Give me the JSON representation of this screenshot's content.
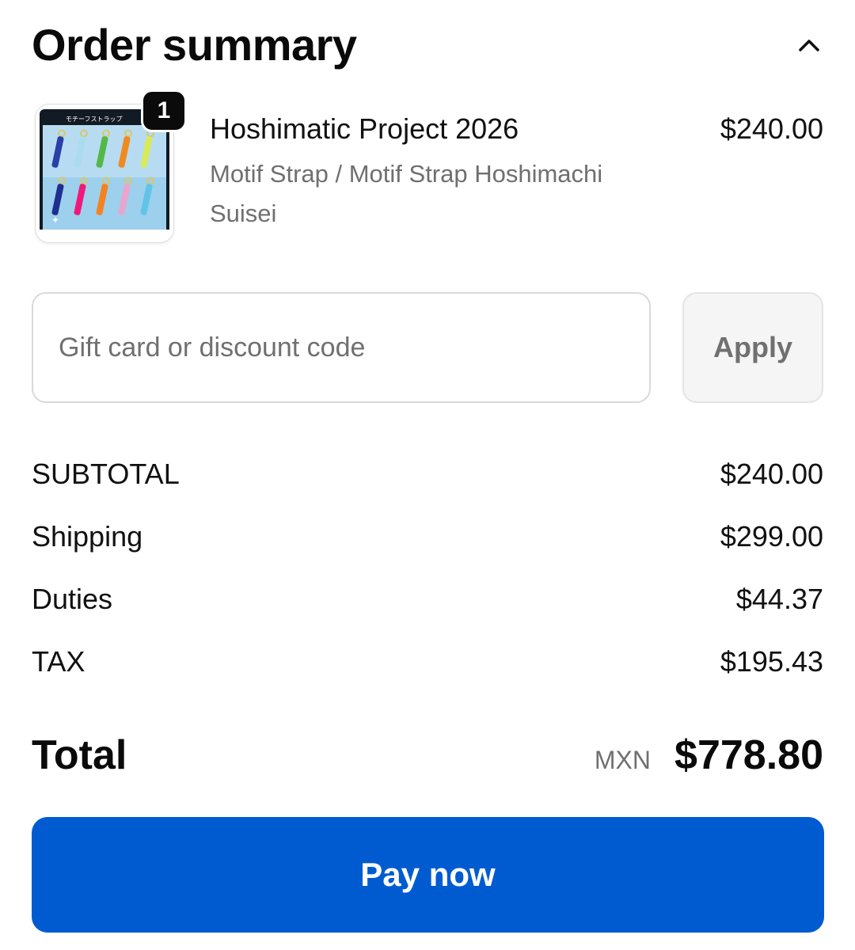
{
  "header": {
    "title": "Order summary",
    "toggle_icon": "chevron-up-icon"
  },
  "line_item": {
    "quantity": "1",
    "name": "Hoshimatic Project 2026",
    "variant": "Motif Strap / Motif Strap Hoshimachi Suisei",
    "price": "$240.00",
    "thumbnail": {
      "heading": "モチーフストラップ",
      "strap_colors": [
        "#2a3fa8",
        "#a9dcef",
        "#54b848",
        "#f08a1c",
        "#d8ea5a",
        "#1f2f8f",
        "#f0197a",
        "#f58220",
        "#e8a6cf",
        "#62c3e8"
      ]
    }
  },
  "discount": {
    "placeholder": "Gift card or discount code",
    "apply_label": "Apply"
  },
  "totals": [
    {
      "label": "SUBTOTAL",
      "value": "$240.00"
    },
    {
      "label": "Shipping",
      "value": "$299.00"
    },
    {
      "label": "Duties",
      "value": "$44.37"
    },
    {
      "label": "TAX",
      "value": "$195.43"
    }
  ],
  "grand_total": {
    "label": "Total",
    "currency": "MXN",
    "amount": "$778.80"
  },
  "pay_button": {
    "label": "Pay now",
    "color": "#005bd1"
  }
}
